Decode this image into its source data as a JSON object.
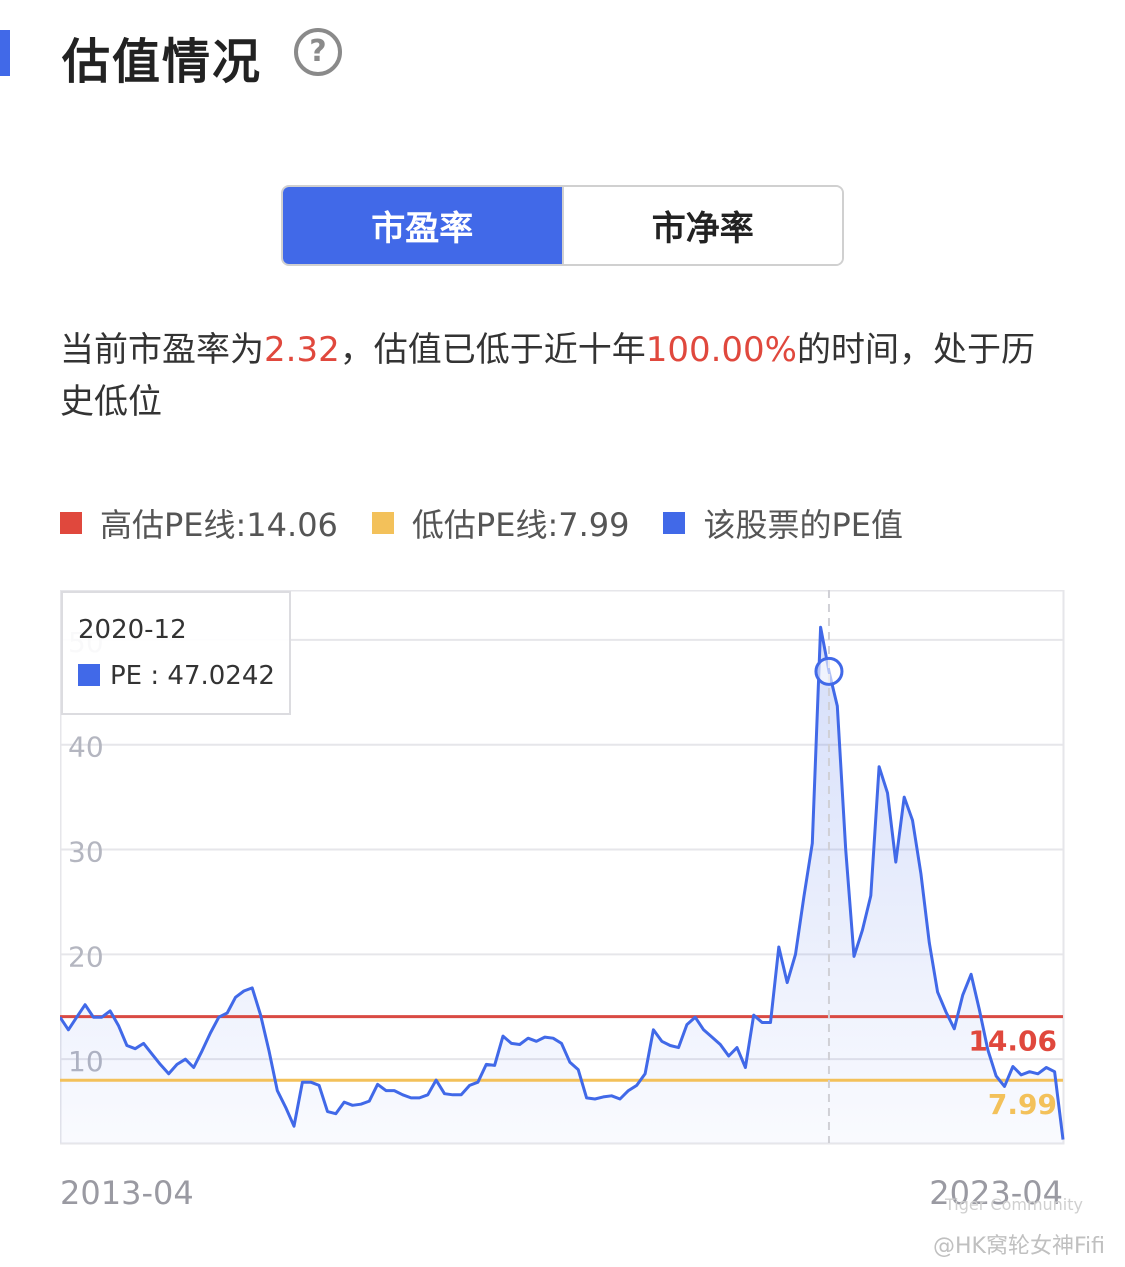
{
  "header": {
    "title": "估值情况",
    "help_glyph": "?"
  },
  "tabs": [
    {
      "label": "市盈率",
      "active": true
    },
    {
      "label": "市净率",
      "active": false
    }
  ],
  "summary": {
    "prefix": "当前市盈率为",
    "pe_value": "2.32",
    "middle": "，估值已低于近十年",
    "percent": "100.00%",
    "suffix": "的时间，处于历史低位"
  },
  "legend": {
    "high_label": "高估PE线:14.06",
    "low_label": "低估PE线:7.99",
    "pe_label": "该股票的PE值"
  },
  "colors": {
    "accent": "#4169e8",
    "high_line": "#d94a43",
    "low_line": "#f3c15a",
    "series": "#4169e8",
    "highlight_text": "#e0483d"
  },
  "tooltip": {
    "date": "2020-12",
    "text": "PE : 47.0242"
  },
  "chart_data": {
    "type": "line",
    "x_start_label": "2013-04",
    "x_end_label": "2023-04",
    "ylim": [
      2,
      54
    ],
    "yticks": [
      "10",
      "20",
      "30",
      "40",
      "50"
    ],
    "grid": true,
    "high_value": "14.06",
    "low_value": "7.99",
    "series": [
      {
        "values": [
          14.0,
          12.8,
          14.0,
          15.2,
          14.0,
          14.0,
          14.6,
          13.2,
          11.3,
          11.0,
          11.5,
          10.5,
          9.5,
          8.6,
          9.5,
          10.0,
          9.2,
          10.8,
          12.5,
          14.0,
          14.4,
          15.9,
          16.5,
          16.8,
          14.2,
          10.8,
          7.0,
          5.4,
          3.6,
          7.8,
          7.8,
          7.5,
          5.0,
          4.8,
          5.9,
          5.6,
          5.7,
          6.0,
          7.6,
          7.0,
          7.0,
          6.6,
          6.3,
          6.3,
          6.6,
          8.0,
          6.7,
          6.6,
          6.6,
          7.5,
          7.8,
          9.5,
          9.4,
          12.2,
          11.5,
          11.4,
          12.0,
          11.7,
          12.1,
          12.0,
          11.5,
          9.7,
          9.0,
          6.3,
          6.2,
          6.4,
          6.5,
          6.2,
          7.0,
          7.5,
          8.6,
          12.8,
          11.7,
          11.3,
          11.1,
          13.3,
          14.0,
          12.8,
          12.1,
          11.4,
          10.3,
          11.1,
          9.2,
          14.2,
          13.5,
          13.5,
          20.7,
          17.3,
          20.0,
          25.5,
          30.6,
          51.2,
          47.0,
          43.7,
          30.0,
          19.8,
          22.3,
          25.6,
          37.9,
          35.4,
          28.8,
          35.0,
          32.8,
          27.7,
          21.1,
          16.4,
          14.5,
          12.9,
          16.1,
          18.1,
          14.7,
          10.9,
          8.4,
          7.4,
          9.3,
          8.5,
          8.8,
          8.6,
          9.2,
          8.8,
          2.32
        ]
      }
    ]
  },
  "watermark": {
    "handle": "@HK窝轮女神Fifi",
    "community": "Tiger Community"
  }
}
